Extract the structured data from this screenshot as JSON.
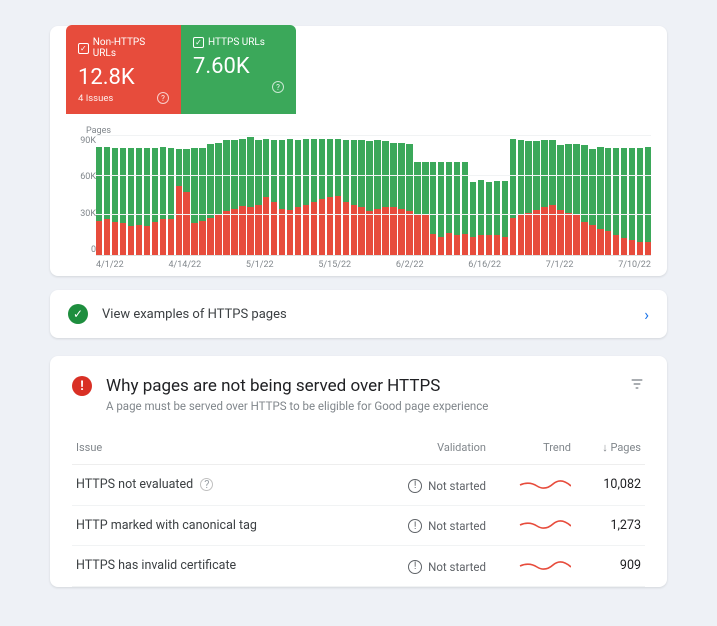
{
  "stats": {
    "nonhttps": {
      "label": "Non-HTTPS URLs",
      "value": "12.8K",
      "footer": "4 Issues"
    },
    "https": {
      "label": "HTTPS URLs",
      "value": "7.60K"
    }
  },
  "chart_data": {
    "type": "bar",
    "title": "Pages",
    "ylabel": "Pages",
    "ylim": [
      0,
      90000
    ],
    "yticks": [
      "90K",
      "60K",
      "30K",
      "0"
    ],
    "categories": [
      "4/1/22",
      "4/14/22",
      "5/1/22",
      "5/15/22",
      "6/2/22",
      "6/16/22",
      "7/1/22",
      "7/10/22"
    ],
    "series": [
      {
        "name": "Non-HTTPS URLs",
        "color": "#e74c3c",
        "values": [
          26000,
          27000,
          25000,
          24000,
          22000,
          23000,
          22000,
          25000,
          27000,
          27000,
          52000,
          48000,
          24000,
          26000,
          28000,
          30000,
          33000,
          35000,
          37000,
          36000,
          38000,
          44000,
          40000,
          35000,
          34000,
          36000,
          38000,
          40000,
          42000,
          44000,
          45000,
          40000,
          38000,
          36000,
          33000,
          35000,
          36000,
          36000,
          35000,
          33000,
          31000,
          30000,
          16000,
          14000,
          17000,
          15000,
          16000,
          14000,
          15000,
          15000,
          15000,
          14000,
          28000,
          30000,
          32000,
          34000,
          36000,
          38000,
          34000,
          32000,
          30000,
          25000,
          23000,
          20000,
          18000,
          15000,
          13000,
          11000,
          10000,
          10000
        ]
      },
      {
        "name": "HTTPS URLs",
        "color": "#3ba85a",
        "values": [
          56000,
          55000,
          56000,
          57000,
          59000,
          58000,
          59000,
          56000,
          55000,
          54000,
          28000,
          32000,
          57000,
          55000,
          56000,
          55000,
          54000,
          52000,
          51000,
          53000,
          49000,
          44000,
          47000,
          52000,
          54000,
          51000,
          50000,
          48000,
          46000,
          44000,
          43000,
          47000,
          49000,
          51000,
          53000,
          52000,
          50000,
          49000,
          50000,
          51000,
          39000,
          40000,
          54000,
          56000,
          53000,
          55000,
          54000,
          41000,
          42000,
          40000,
          41000,
          42000,
          60000,
          57000,
          54000,
          52000,
          51000,
          49000,
          49000,
          52000,
          54000,
          58000,
          57000,
          62000,
          63000,
          66000,
          68000,
          70000,
          71000,
          72000
        ]
      }
    ]
  },
  "examples_label": "View examples of HTTPS pages",
  "issues": {
    "title": "Why pages are not being served over HTTPS",
    "subtitle": "A page must be served over HTTPS to be eligible for Good page experience",
    "columns": {
      "issue": "Issue",
      "validation": "Validation",
      "trend": "Trend",
      "pages": "Pages"
    },
    "not_started": "Not started",
    "rows": [
      {
        "issue": "HTTPS not evaluated",
        "info": true,
        "validation": "Not started",
        "pages": "10,082"
      },
      {
        "issue": "HTTP marked with canonical tag",
        "info": false,
        "validation": "Not started",
        "pages": "1,273"
      },
      {
        "issue": "HTTPS has invalid certificate",
        "info": false,
        "validation": "Not started",
        "pages": "909"
      }
    ]
  }
}
